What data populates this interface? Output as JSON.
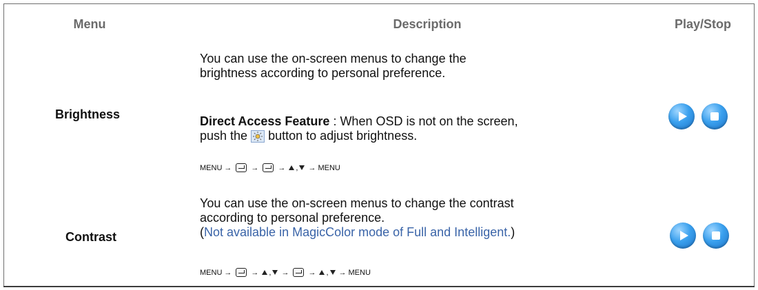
{
  "table": {
    "headers": {
      "menu": "Menu",
      "description": "Description",
      "play_stop": "Play/Stop"
    },
    "rows": [
      {
        "menu": "Brightness",
        "description_line1": "You can use the on-screen menus to change the",
        "description_line2": "brightness according to personal preference.",
        "direct_access_label": "Direct Access Feature",
        "direct_access_text": " : When OSD is not on the screen,",
        "direct_access_line2_pre": "push the ",
        "direct_access_line2_post": " button to adjust brightness.",
        "sequence": [
          "MENU",
          "→",
          "enter-key",
          "→",
          "enter-key",
          "→",
          "up-triangle",
          ",",
          "down-triangle",
          "→",
          "MENU"
        ]
      },
      {
        "menu": "Contrast",
        "description_line1": "You can use the on-screen menus to change the contrast",
        "description_line2": "according to personal preference.",
        "note_open": "(",
        "note_text": "Not available in MagicColor mode of Full and Intelligent.",
        "note_close": ")",
        "sequence": [
          "MENU",
          "→",
          "enter-key",
          "→",
          "up-triangle",
          ",",
          "down-triangle",
          "→",
          "enter-key",
          "→",
          "up-triangle",
          ",",
          "down-triangle",
          "→",
          "MENU"
        ]
      }
    ]
  },
  "labels": {
    "menu_text": "MENU",
    "arrow_text": "→",
    "comma_text": ","
  },
  "icons": {
    "play": "play-icon",
    "stop": "stop-icon",
    "brightness": "brightness-icon",
    "enter_key": "enter-key-icon"
  },
  "colors": {
    "header": "#6b6b6b",
    "note": "#3a64a8",
    "button": "#3aa0ee"
  }
}
